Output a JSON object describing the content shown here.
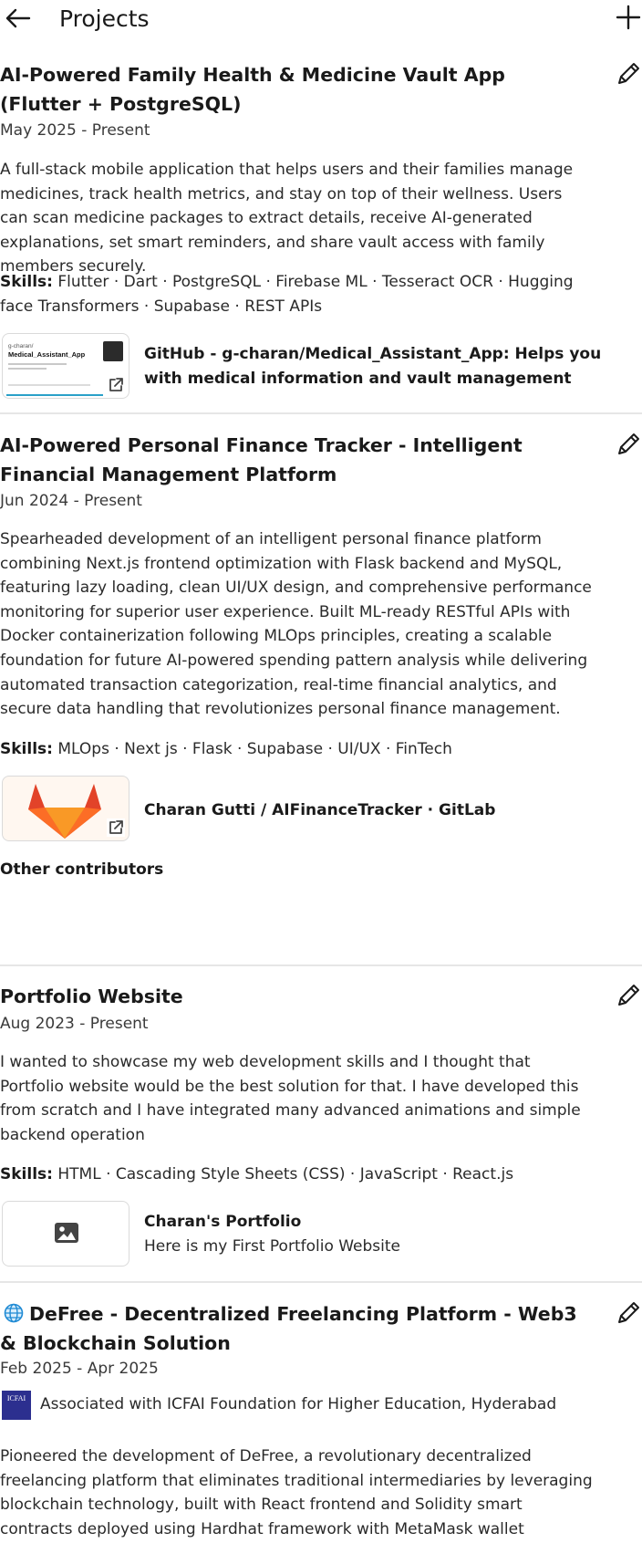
{
  "header": {
    "title": "Projects",
    "back_icon": "arrow-left-icon",
    "add_icon": "plus-icon"
  },
  "projects": [
    {
      "title": "AI-Powered Family Health & Medicine Vault App (Flutter + PostgreSQL)",
      "date": "May 2025 - Present",
      "description": "A full-stack mobile application that helps users and their families manage medicines, track health metrics, and stay on top of their wellness. Users can scan medicine packages to extract details, receive AI-generated explanations, set smart reminders, and share vault access with family members securely.",
      "skills_label": "Skills:",
      "skills": "Flutter · Dart · PostgreSQL · Firebase ML · Tesseract OCR · Hugging face Transformers · Supabase · REST APIs",
      "media": {
        "title": "GitHub - g-charan/Medical_Assistant_App: Helps you with medical information and vault management",
        "thumb_path": "g-charan/",
        "thumb_repo": "Medical_Assistant_App"
      }
    },
    {
      "title": "AI-Powered Personal Finance Tracker - Intelligent Financial Management Platform",
      "date": "Jun 2024 - Present",
      "description": "Spearheaded development of an intelligent personal finance platform combining Next.js frontend optimization with Flask backend and MySQL, featuring lazy loading, clean UI/UX design, and comprehensive performance monitoring for superior user experience. Built ML-ready RESTful APIs with Docker containerization following MLOps principles, creating a scalable foundation for future AI-powered spending pattern analysis while delivering automated transaction categorization, real-time financial analytics, and secure data handling that revolutionizes personal finance management.",
      "skills_label": "Skills:",
      "skills": "MLOps · Next js · Flask · Supabase · UI/UX · FinTech",
      "media": {
        "title": "Charan Gutti / AIFinanceTracker · GitLab"
      },
      "contributors_label": "Other contributors"
    },
    {
      "title": "Portfolio Website",
      "date": "Aug 2023 - Present",
      "description": "I wanted to showcase my web development skills and I thought that Portfolio website would be the best solution for that. I have developed this from scratch and I have integrated many advanced animations and simple backend operation",
      "skills_label": "Skills:",
      "skills": "HTML · Cascading Style Sheets (CSS) · JavaScript · React.js",
      "media": {
        "title": "Charan's Portfolio",
        "subtitle": "Here is my First Portfolio Website"
      }
    },
    {
      "title": "DeFree - Decentralized Freelancing Platform - Web3 & Blockchain Solution",
      "date": "Feb 2025 - Apr 2025",
      "association": "Associated with ICFAI Foundation for Higher Education, Hyderabad",
      "association_logo_text": "ICFAI",
      "description": "Pioneered the development of DeFree, a revolutionary decentralized freelancing platform that eliminates traditional intermediaries by leveraging blockchain technology, built with React frontend and Solidity smart contracts deployed using Hardhat framework with MetaMask wallet integration."
    }
  ],
  "colors": {
    "text": "#1a1a1a",
    "divider": "#e6e6e6",
    "gitlab_orange": "#e24329",
    "gitlab_light": "#fca326",
    "link_bar": "#2aa0c8",
    "icfai_blue": "#2c2f8f"
  }
}
